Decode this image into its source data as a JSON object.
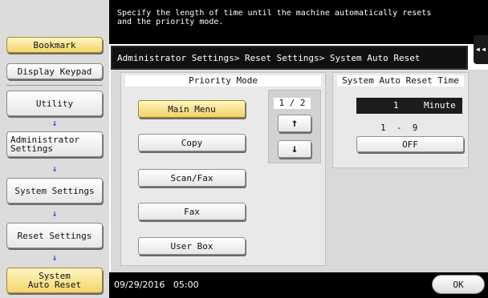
{
  "message": "Specify the length of time until the machine automatically resets\nand the priority mode.",
  "left_nav": {
    "bookmark": "Bookmark",
    "display_keypad": "Display Keypad",
    "utility": "Utility",
    "administrator_settings": "Administrator\nSettings",
    "system_settings": "System Settings",
    "reset_settings": "Reset Settings",
    "system_auto_reset": "System\nAuto Reset",
    "arrow_glyph": "↓"
  },
  "breadcrumb": "Administrator Settings> Reset Settings> System Auto Reset",
  "side_tab_glyph": "◂◂",
  "priority_mode": {
    "title": "Priority Mode",
    "options": [
      "Main Menu",
      "Copy",
      "Scan/Fax",
      "Fax",
      "User Box"
    ],
    "selected": "Main Menu",
    "page": "1 / 2",
    "up_glyph": "↑",
    "down_glyph": "↓"
  },
  "auto_reset_time": {
    "title": "System Auto Reset Time",
    "value": "1",
    "unit": "Minute",
    "range": "1  -  9",
    "off_label": "OFF"
  },
  "footer": {
    "datetime": "09/29/2016   05:00",
    "ok_label": "OK"
  }
}
